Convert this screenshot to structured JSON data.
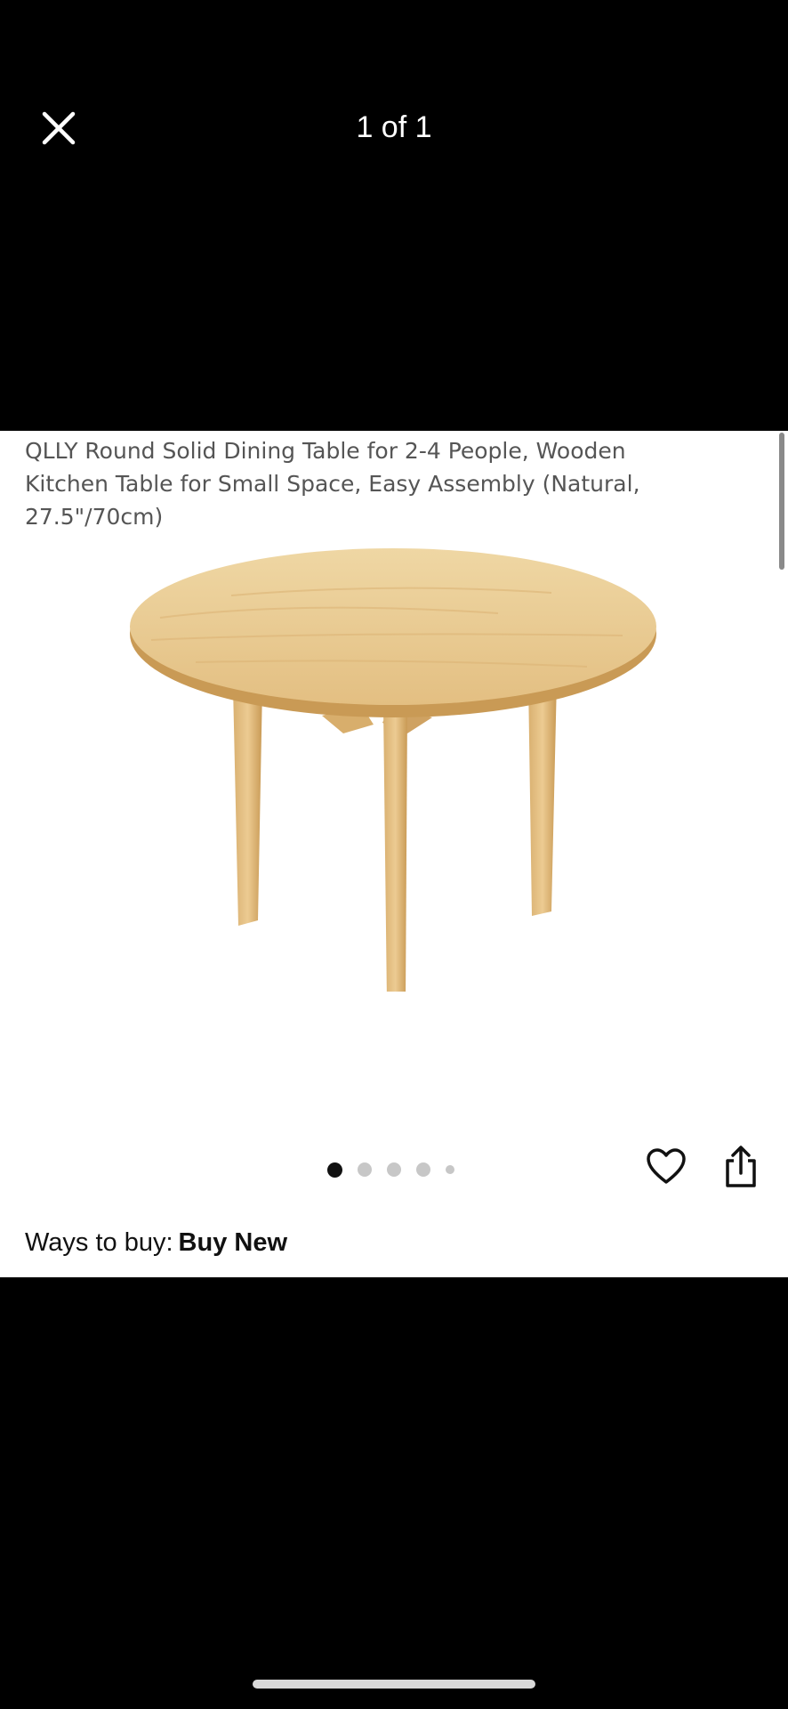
{
  "header": {
    "close_icon": "close-icon",
    "counter": "1 of 1"
  },
  "product": {
    "title": "QLLY Round Solid Dining Table for 2-4 People, Wooden Kitchen Table for Small Space, Easy Assembly (Natural, 27.5\"/70cm)",
    "image_alt": "Round natural wood dining table with three legs"
  },
  "carousel": {
    "dot_count": 5,
    "active_index": 0
  },
  "actions": {
    "favorite_icon": "heart-icon",
    "share_icon": "share-icon"
  },
  "purchase": {
    "ways_label": "Ways to buy:",
    "ways_value": "Buy New"
  },
  "colors": {
    "background": "#000000",
    "card": "#ffffff",
    "wood_light": "#e9c98e",
    "wood_dark": "#c99a55"
  }
}
